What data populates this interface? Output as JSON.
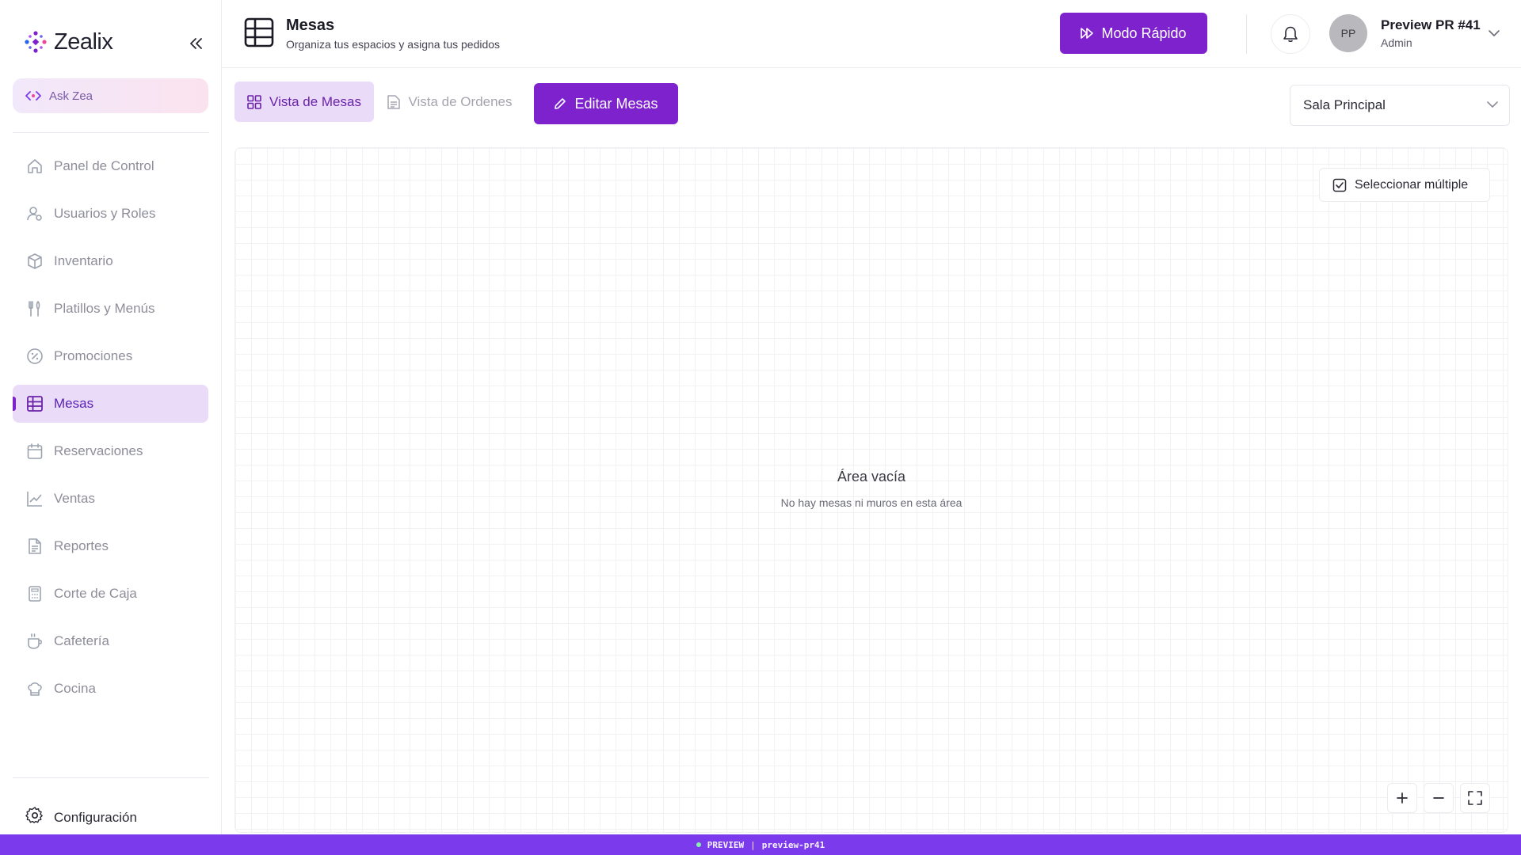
{
  "brand": {
    "name": "Zealix"
  },
  "ask_zea": {
    "label": "Ask Zea"
  },
  "sidebar": {
    "items": [
      {
        "label": "Panel de Control",
        "icon": "home-icon"
      },
      {
        "label": "Usuarios y Roles",
        "icon": "users-icon"
      },
      {
        "label": "Inventario",
        "icon": "box-icon"
      },
      {
        "label": "Platillos y Menús",
        "icon": "utensils-icon"
      },
      {
        "label": "Promociones",
        "icon": "percent-badge-icon"
      },
      {
        "label": "Mesas",
        "icon": "table-grid-icon",
        "active": true
      },
      {
        "label": "Reservaciones",
        "icon": "calendar-icon"
      },
      {
        "label": "Ventas",
        "icon": "line-chart-icon"
      },
      {
        "label": "Reportes",
        "icon": "file-text-icon"
      },
      {
        "label": "Corte de Caja",
        "icon": "calculator-icon"
      },
      {
        "label": "Cafetería",
        "icon": "coffee-icon"
      },
      {
        "label": "Cocina",
        "icon": "chef-hat-icon"
      }
    ],
    "settings_label": "Configuración"
  },
  "header": {
    "title": "Mesas",
    "subtitle": "Organiza tus espacios y asigna tus pedidos",
    "quick_mode_label": "Modo Rápido",
    "user": {
      "initials": "PP",
      "name": "Preview PR #41",
      "role": "Admin"
    }
  },
  "toolbar": {
    "tab_tables": "Vista de Mesas",
    "tab_orders": "Vista de Ordenes",
    "edit_tables": "Editar Mesas",
    "room_select": "Sala Principal"
  },
  "canvas": {
    "multi_select_label": "Seleccionar múltiple",
    "empty_title": "Área vacía",
    "empty_desc": "No hay mesas ni muros en esta área"
  },
  "preview_bar": {
    "tag": "PREVIEW",
    "separator": "|",
    "env": "preview-pr41"
  },
  "colors": {
    "accent": "#7e22ce",
    "active_bg": "#eadcf9",
    "preview_bar": "#7c3aed"
  }
}
